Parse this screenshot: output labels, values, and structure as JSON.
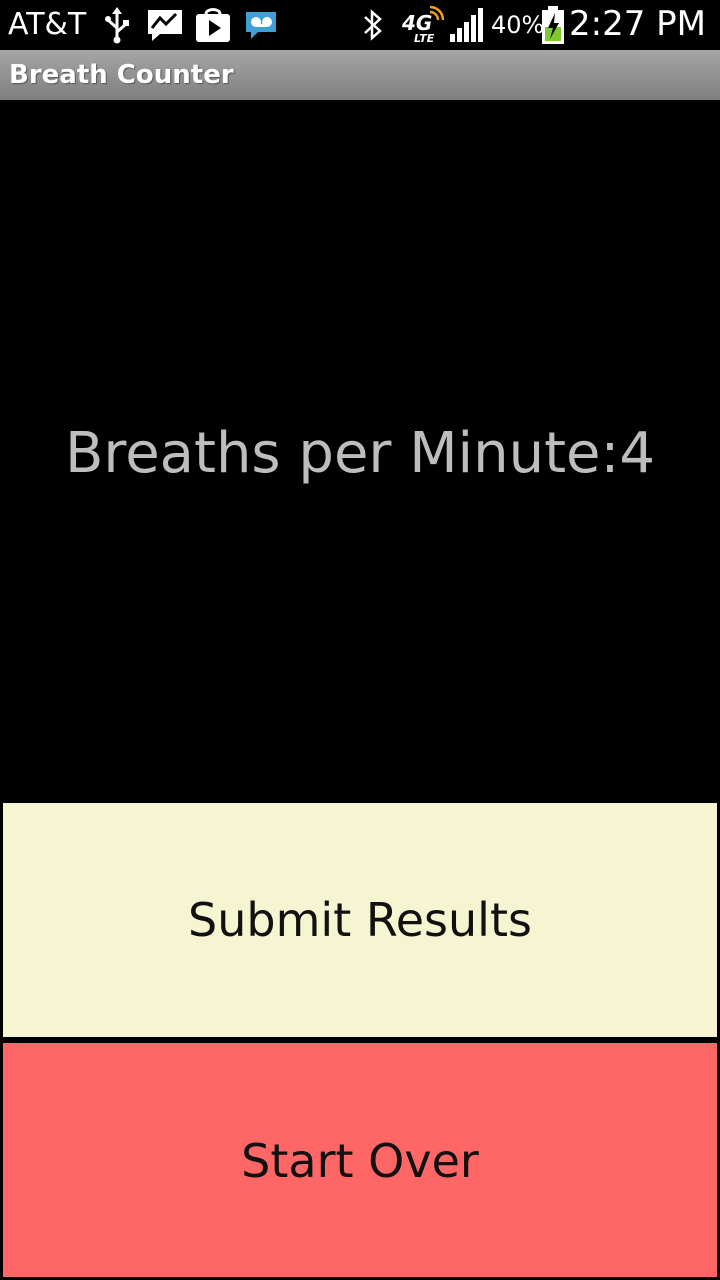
{
  "status_bar": {
    "carrier": "AT&T",
    "icons": [
      "usb-icon",
      "messenger-icon",
      "play-store-icon",
      "voicemail-icon",
      "bluetooth-icon",
      "4g-lte-icon",
      "signal-icon",
      "battery-charging-icon"
    ],
    "network_label": "4G",
    "network_sub_label": "LTE",
    "battery": "40%",
    "time": "2:27 PM"
  },
  "app": {
    "title": "Breath Counter"
  },
  "main": {
    "breaths_label": "Breaths per Minute:4"
  },
  "buttons": {
    "submit_label": "Submit Results",
    "start_over_label": "Start Over"
  },
  "colors": {
    "submit_bg": "#f5f6d1",
    "start_over_bg": "#ff6666",
    "text_gray": "#bdbdbd"
  }
}
